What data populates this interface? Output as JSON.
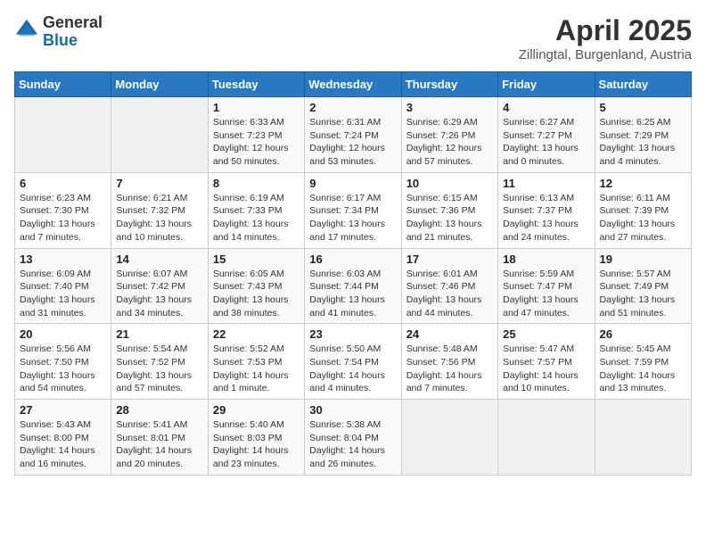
{
  "logo": {
    "general": "General",
    "blue": "Blue"
  },
  "title": "April 2025",
  "subtitle": "Zillingtal, Burgenland, Austria",
  "days_of_week": [
    "Sunday",
    "Monday",
    "Tuesday",
    "Wednesday",
    "Thursday",
    "Friday",
    "Saturday"
  ],
  "weeks": [
    [
      {
        "day": "",
        "info": ""
      },
      {
        "day": "",
        "info": ""
      },
      {
        "day": "1",
        "info": "Sunrise: 6:33 AM\nSunset: 7:23 PM\nDaylight: 12 hours and 50 minutes."
      },
      {
        "day": "2",
        "info": "Sunrise: 6:31 AM\nSunset: 7:24 PM\nDaylight: 12 hours and 53 minutes."
      },
      {
        "day": "3",
        "info": "Sunrise: 6:29 AM\nSunset: 7:26 PM\nDaylight: 12 hours and 57 minutes."
      },
      {
        "day": "4",
        "info": "Sunrise: 6:27 AM\nSunset: 7:27 PM\nDaylight: 13 hours and 0 minutes."
      },
      {
        "day": "5",
        "info": "Sunrise: 6:25 AM\nSunset: 7:29 PM\nDaylight: 13 hours and 4 minutes."
      }
    ],
    [
      {
        "day": "6",
        "info": "Sunrise: 6:23 AM\nSunset: 7:30 PM\nDaylight: 13 hours and 7 minutes."
      },
      {
        "day": "7",
        "info": "Sunrise: 6:21 AM\nSunset: 7:32 PM\nDaylight: 13 hours and 10 minutes."
      },
      {
        "day": "8",
        "info": "Sunrise: 6:19 AM\nSunset: 7:33 PM\nDaylight: 13 hours and 14 minutes."
      },
      {
        "day": "9",
        "info": "Sunrise: 6:17 AM\nSunset: 7:34 PM\nDaylight: 13 hours and 17 minutes."
      },
      {
        "day": "10",
        "info": "Sunrise: 6:15 AM\nSunset: 7:36 PM\nDaylight: 13 hours and 21 minutes."
      },
      {
        "day": "11",
        "info": "Sunrise: 6:13 AM\nSunset: 7:37 PM\nDaylight: 13 hours and 24 minutes."
      },
      {
        "day": "12",
        "info": "Sunrise: 6:11 AM\nSunset: 7:39 PM\nDaylight: 13 hours and 27 minutes."
      }
    ],
    [
      {
        "day": "13",
        "info": "Sunrise: 6:09 AM\nSunset: 7:40 PM\nDaylight: 13 hours and 31 minutes."
      },
      {
        "day": "14",
        "info": "Sunrise: 6:07 AM\nSunset: 7:42 PM\nDaylight: 13 hours and 34 minutes."
      },
      {
        "day": "15",
        "info": "Sunrise: 6:05 AM\nSunset: 7:43 PM\nDaylight: 13 hours and 38 minutes."
      },
      {
        "day": "16",
        "info": "Sunrise: 6:03 AM\nSunset: 7:44 PM\nDaylight: 13 hours and 41 minutes."
      },
      {
        "day": "17",
        "info": "Sunrise: 6:01 AM\nSunset: 7:46 PM\nDaylight: 13 hours and 44 minutes."
      },
      {
        "day": "18",
        "info": "Sunrise: 5:59 AM\nSunset: 7:47 PM\nDaylight: 13 hours and 47 minutes."
      },
      {
        "day": "19",
        "info": "Sunrise: 5:57 AM\nSunset: 7:49 PM\nDaylight: 13 hours and 51 minutes."
      }
    ],
    [
      {
        "day": "20",
        "info": "Sunrise: 5:56 AM\nSunset: 7:50 PM\nDaylight: 13 hours and 54 minutes."
      },
      {
        "day": "21",
        "info": "Sunrise: 5:54 AM\nSunset: 7:52 PM\nDaylight: 13 hours and 57 minutes."
      },
      {
        "day": "22",
        "info": "Sunrise: 5:52 AM\nSunset: 7:53 PM\nDaylight: 14 hours and 1 minute."
      },
      {
        "day": "23",
        "info": "Sunrise: 5:50 AM\nSunset: 7:54 PM\nDaylight: 14 hours and 4 minutes."
      },
      {
        "day": "24",
        "info": "Sunrise: 5:48 AM\nSunset: 7:56 PM\nDaylight: 14 hours and 7 minutes."
      },
      {
        "day": "25",
        "info": "Sunrise: 5:47 AM\nSunset: 7:57 PM\nDaylight: 14 hours and 10 minutes."
      },
      {
        "day": "26",
        "info": "Sunrise: 5:45 AM\nSunset: 7:59 PM\nDaylight: 14 hours and 13 minutes."
      }
    ],
    [
      {
        "day": "27",
        "info": "Sunrise: 5:43 AM\nSunset: 8:00 PM\nDaylight: 14 hours and 16 minutes."
      },
      {
        "day": "28",
        "info": "Sunrise: 5:41 AM\nSunset: 8:01 PM\nDaylight: 14 hours and 20 minutes."
      },
      {
        "day": "29",
        "info": "Sunrise: 5:40 AM\nSunset: 8:03 PM\nDaylight: 14 hours and 23 minutes."
      },
      {
        "day": "30",
        "info": "Sunrise: 5:38 AM\nSunset: 8:04 PM\nDaylight: 14 hours and 26 minutes."
      },
      {
        "day": "",
        "info": ""
      },
      {
        "day": "",
        "info": ""
      },
      {
        "day": "",
        "info": ""
      }
    ]
  ]
}
